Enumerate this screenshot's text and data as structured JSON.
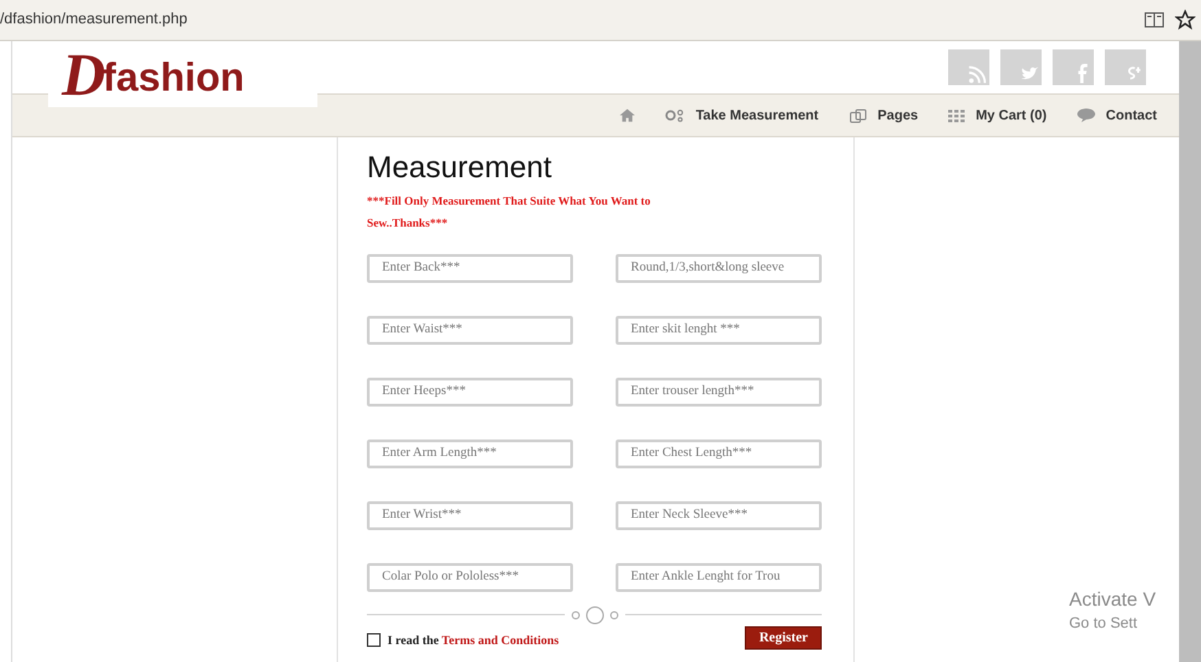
{
  "browser": {
    "address": "/dfashion/measurement.php"
  },
  "logo": {
    "letter": "D",
    "text": "fashion"
  },
  "social": [
    {
      "kind": "rss"
    },
    {
      "kind": "twitter"
    },
    {
      "kind": "facebook"
    },
    {
      "kind": "googleplus"
    }
  ],
  "nav": [
    {
      "kind": "home"
    },
    {
      "kind": "measure",
      "label": "Take Measurement"
    },
    {
      "kind": "pages",
      "label": "Pages"
    },
    {
      "kind": "cart",
      "label": "My Cart (0)"
    },
    {
      "kind": "contact",
      "label": "Contact"
    }
  ],
  "form": {
    "title": "Measurement",
    "notice": "***Fill Only Measurement That Suite What You Want to Sew..Thanks***",
    "fields": [
      {
        "placeholder": "Enter Back***"
      },
      {
        "placeholder": "Round,1/3,short&long sleeve"
      },
      {
        "placeholder": "Enter Waist***"
      },
      {
        "placeholder": "Enter skit lenght ***"
      },
      {
        "placeholder": "Enter Heeps***"
      },
      {
        "placeholder": "Enter trouser length***"
      },
      {
        "placeholder": "Enter Arm Length***"
      },
      {
        "placeholder": "Enter Chest Length***"
      },
      {
        "placeholder": "Enter Wrist***"
      },
      {
        "placeholder": "Enter Neck Sleeve***"
      },
      {
        "placeholder": "Colar Polo or Pololess***"
      },
      {
        "placeholder": "Enter Ankle Lenght for Trou"
      }
    ],
    "agree": {
      "checked": false,
      "text": "I read the",
      "link": "Terms and Conditions"
    },
    "submit": "Register"
  },
  "os_notice": {
    "line1": "Activate V",
    "line2": "Go to Sett"
  }
}
